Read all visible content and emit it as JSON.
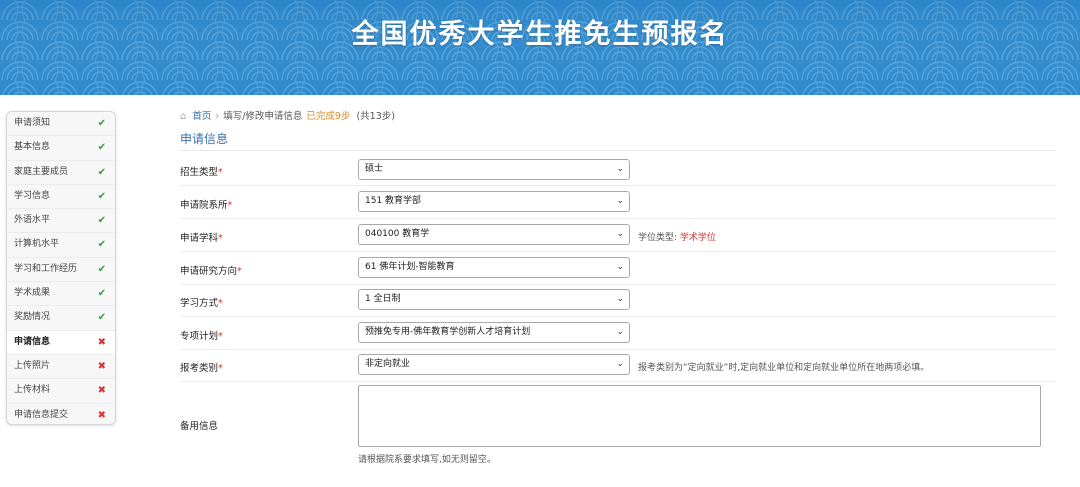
{
  "header": {
    "title": "全国优秀大学生推免生预报名"
  },
  "sidebar": {
    "items": [
      {
        "label": "申请须知",
        "status": "done"
      },
      {
        "label": "基本信息",
        "status": "done"
      },
      {
        "label": "家庭主要成员",
        "status": "done"
      },
      {
        "label": "学习信息",
        "status": "done"
      },
      {
        "label": "外语水平",
        "status": "done"
      },
      {
        "label": "计算机水平",
        "status": "done"
      },
      {
        "label": "学习和工作经历",
        "status": "done"
      },
      {
        "label": "学术成果",
        "status": "done"
      },
      {
        "label": "奖励情况",
        "status": "done"
      },
      {
        "label": "申请信息",
        "status": "pending",
        "active": true
      },
      {
        "label": "上传照片",
        "status": "pending"
      },
      {
        "label": "上传材料",
        "status": "pending"
      },
      {
        "label": "申请信息提交",
        "status": "pending"
      }
    ],
    "done_mark": "✔",
    "pending_mark": "✖"
  },
  "breadcrumb": {
    "home": "首页",
    "current": "填写/修改申请信息",
    "progress": "已完成9步",
    "total": "(共13步)"
  },
  "section": {
    "title": "申请信息"
  },
  "form": {
    "admission_type": {
      "label": "招生类型",
      "value": "硕士"
    },
    "department": {
      "label": "申请院系所",
      "value": "151 教育学部"
    },
    "subject": {
      "label": "申请学科",
      "value": "040100 教育学",
      "degree_type_label": "学位类型:",
      "degree_type_value": "学术学位"
    },
    "research_direction": {
      "label": "申请研究方向",
      "value": "61 佛年计划-智能教育"
    },
    "study_mode": {
      "label": "学习方式",
      "value": "1 全日制"
    },
    "special_plan": {
      "label": "专项计划",
      "value": "预推免专用-佛年教育学创新人才培育计划"
    },
    "exam_category": {
      "label": "报考类别",
      "value": "非定向就业",
      "hint": "报考类别为“定向就业”时,定向就业单位和定向就业单位所在地两项必填。"
    },
    "remarks": {
      "label": "备用信息",
      "value": "",
      "note": "请根据院系要求填写,如无则留空。"
    }
  },
  "colors": {
    "banner": "#2d86c8",
    "accent": "#3a70b0",
    "done": "#3a9a3a",
    "pending": "#d63333",
    "progress": "#e08a1e"
  }
}
